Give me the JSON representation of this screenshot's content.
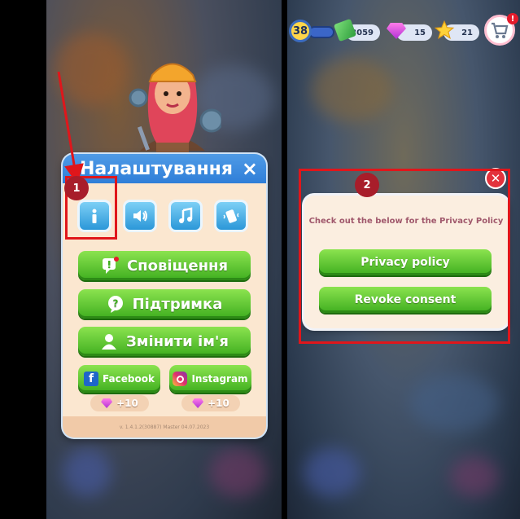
{
  "settings": {
    "title": "Налаштування",
    "close_icon": "×",
    "icon_buttons": [
      "info-icon",
      "speaker-icon",
      "music-note-icon",
      "vibration-icon"
    ],
    "buttons": {
      "notifications": "Сповіщення",
      "support": "Підтримка",
      "change_name": "Змінити ім'я"
    },
    "social": {
      "facebook": "Facebook",
      "instagram": "Instagram",
      "facebook_reward": "+10",
      "instagram_reward": "+10"
    },
    "version": "v. 1.4.1.2(30887) Master 04.07.2023"
  },
  "annotations": {
    "step1": "1",
    "step2": "2"
  },
  "top_bar": {
    "level": "38",
    "cash": "3059",
    "gems": "15",
    "stars": "21",
    "shop_alert": "!"
  },
  "privacy": {
    "text": "Check out the below for the Privacy Policy",
    "privacy_button": "Privacy policy",
    "revoke_button": "Revoke consent",
    "close_icon": "✕"
  },
  "colors": {
    "annotation_red": "#e0161b",
    "header_blue": "#2f7ed8",
    "button_green": "#3fae1f"
  }
}
